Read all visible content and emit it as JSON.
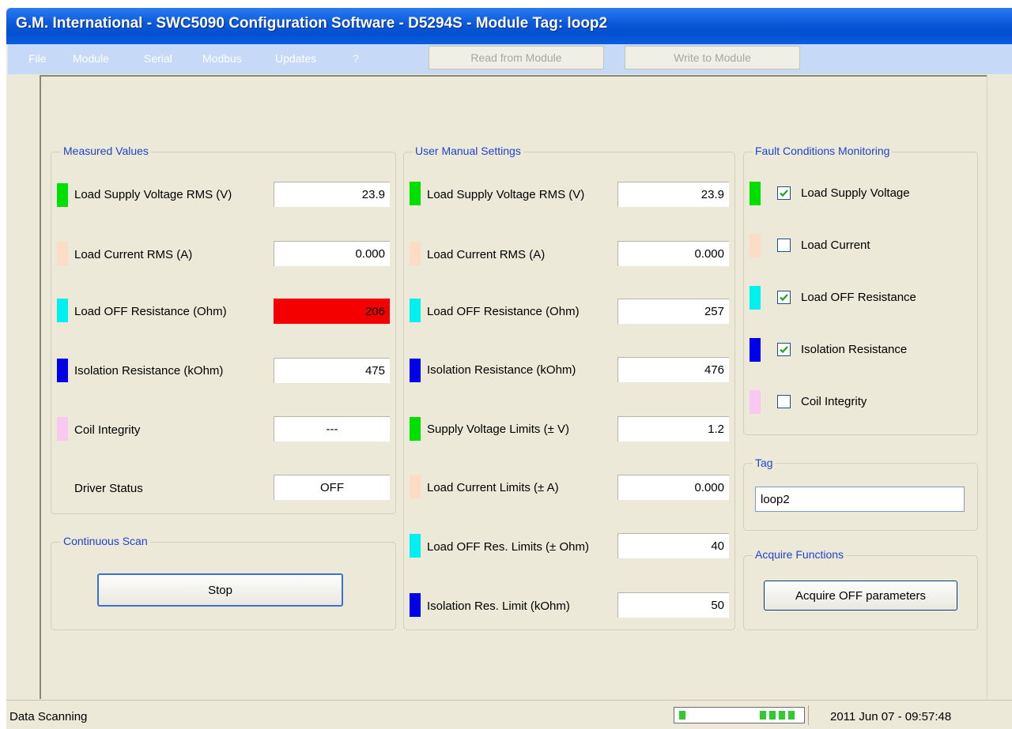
{
  "window": {
    "title": "G.M. International - SWC5090 Configuration Software - D5294S - Module Tag: loop2"
  },
  "menu": [
    "File",
    "Module",
    "Serial",
    "Modbus",
    "Updates",
    "?"
  ],
  "toolbar": {
    "read_label": "Read from Module",
    "write_label": "Write to Module"
  },
  "measured": {
    "title": "Measured Values",
    "rows": [
      {
        "label": "Load Supply Voltage RMS (V)",
        "value": "23.9",
        "color": "#00e000"
      },
      {
        "label": "Load Current RMS (A)",
        "value": "0.000",
        "color": "#fcdcc4"
      },
      {
        "label": "Load OFF Resistance (Ohm)",
        "value": "206",
        "color": "#00f0f0",
        "alarm_color": "#f40000"
      },
      {
        "label": "Isolation Resistance (kOhm)",
        "value": "475",
        "color": "#0000e8"
      },
      {
        "label": "Coil Integrity",
        "value": "---",
        "color": "#f8c8f0"
      },
      {
        "label": "Driver Status",
        "value": "OFF"
      }
    ]
  },
  "scan": {
    "title": "Continuous Scan",
    "button": "Stop"
  },
  "manual": {
    "title": "User Manual Settings",
    "rows": [
      {
        "label": "Load Supply Voltage RMS (V)",
        "value": "23.9",
        "color": "#00e000"
      },
      {
        "label": "Load Current RMS (A)",
        "value": "0.000",
        "color": "#fcdcc4"
      },
      {
        "label": "Load OFF Resistance (Ohm)",
        "value": "257",
        "color": "#00f0f0"
      },
      {
        "label": "Isolation Resistance (kOhm)",
        "value": "476",
        "color": "#0000e8"
      },
      {
        "label": "Supply Voltage Limits (± V)",
        "value": "1.2",
        "color": "#00e000"
      },
      {
        "label": "Load Current Limits (± A)",
        "value": "0.000",
        "color": "#fcdcc4"
      },
      {
        "label": "Load OFF Res. Limits (± Ohm)",
        "value": "40",
        "color": "#00f0f0"
      },
      {
        "label": "Isolation Res. Limit (kOhm)",
        "value": "50",
        "color": "#0000e8"
      }
    ]
  },
  "fault": {
    "title": "Fault Conditions Monitoring",
    "items": [
      {
        "label": "Load Supply Voltage",
        "checked": true,
        "color": "#00e000"
      },
      {
        "label": "Load Current",
        "checked": false,
        "color": "#fcdcc4"
      },
      {
        "label": "Load OFF Resistance",
        "checked": true,
        "color": "#00f0f0"
      },
      {
        "label": "Isolation Resistance",
        "checked": true,
        "color": "#0000e8"
      },
      {
        "label": "Coil Integrity",
        "checked": false,
        "color": "#f8c8f0"
      }
    ]
  },
  "tag": {
    "title": "Tag",
    "value": "loop2"
  },
  "acquire": {
    "title": "Acquire Functions",
    "button": "Acquire OFF parameters"
  },
  "status": {
    "text": "Data Scanning",
    "datetime": "2011 Jun 07 - 09:57:48"
  }
}
